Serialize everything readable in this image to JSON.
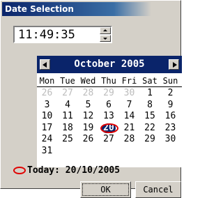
{
  "window": {
    "title": "Date Selection"
  },
  "time": {
    "value": "11:49:35"
  },
  "calendar": {
    "month_label": "October 2005",
    "weekdays": [
      "Mon",
      "Tue",
      "Wed",
      "Thu",
      "Fri",
      "Sat",
      "Sun"
    ],
    "weeks": [
      [
        {
          "d": "26",
          "other": true
        },
        {
          "d": "27",
          "other": true
        },
        {
          "d": "28",
          "other": true
        },
        {
          "d": "29",
          "other": true
        },
        {
          "d": "30",
          "other": true
        },
        {
          "d": "1"
        },
        {
          "d": "2"
        }
      ],
      [
        {
          "d": "3"
        },
        {
          "d": "4"
        },
        {
          "d": "5"
        },
        {
          "d": "6"
        },
        {
          "d": "7"
        },
        {
          "d": "8"
        },
        {
          "d": "9"
        }
      ],
      [
        {
          "d": "10"
        },
        {
          "d": "11"
        },
        {
          "d": "12"
        },
        {
          "d": "13"
        },
        {
          "d": "14"
        },
        {
          "d": "15"
        },
        {
          "d": "16"
        }
      ],
      [
        {
          "d": "17"
        },
        {
          "d": "18"
        },
        {
          "d": "19"
        },
        {
          "d": "20",
          "selected": true,
          "today": true
        },
        {
          "d": "21"
        },
        {
          "d": "22"
        },
        {
          "d": "23"
        }
      ],
      [
        {
          "d": "24"
        },
        {
          "d": "25"
        },
        {
          "d": "26"
        },
        {
          "d": "27"
        },
        {
          "d": "28"
        },
        {
          "d": "29"
        },
        {
          "d": "30"
        }
      ],
      [
        {
          "d": "31"
        }
      ]
    ],
    "colors": {
      "header": "#0a246a",
      "today_circle": "#e00000",
      "other_month": "#bcbcbc"
    }
  },
  "today": {
    "label": "Today: 20/10/2005"
  },
  "buttons": {
    "ok": "OK",
    "cancel": "Cancel"
  }
}
